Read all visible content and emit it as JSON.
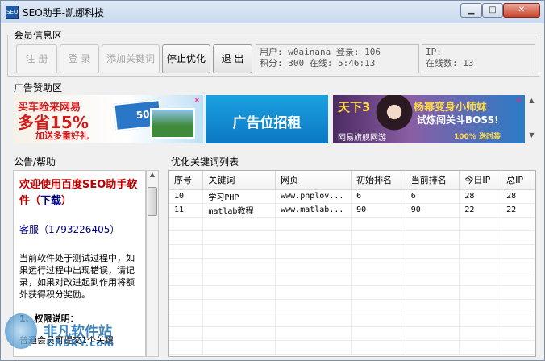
{
  "window": {
    "title": "SEO助手-凯娜科技",
    "app_icon_text": "SEO",
    "min_label": "▁",
    "max_label": "□",
    "close_label": "✕"
  },
  "member": {
    "label": "会员信息区",
    "register": "注 册",
    "login": "登 录",
    "add_keyword": "添加关键词",
    "stop": "停止优化",
    "exit": "退 出",
    "user_line": "用户: w0ainana 登录: 106",
    "score_line": "积分: 300 在线: 5:46:13",
    "ip_line": "IP:",
    "online_line": "在线数: 13"
  },
  "ads": {
    "label": "广告赞助区",
    "ad1_line1": "买车险来网易",
    "ad1_line2": "多省15%",
    "ad1_line3": "加送多重好礼",
    "ad1_badge": "500",
    "ad2_text": "广告位招租",
    "ad3_logo": "天下3",
    "ad3_line1": "杨幂变身小师妹",
    "ad3_line2": "试炼闯关斗BOSS!",
    "ad3_line3": "网易旗舰网游",
    "ad3_badge": "100% 送时装",
    "ad_close": "✕"
  },
  "notice": {
    "label": "公告/帮助",
    "headline": "欢迎使用百度SEO助手软件（",
    "download": "下载",
    "headline_end": "）",
    "service": "客服（1793226405）",
    "paragraph": "当前软件处于测试过程中，如果运行过程中出现错误，请记录，如果对改进起到作用将额外获得积分奖励。",
    "section1": "1、权限说明：",
    "cut_line": "普通会员可提交1个关键"
  },
  "table": {
    "label": "优化关键词列表",
    "columns": [
      "序号",
      "关键词",
      "网页",
      "初始排名",
      "当前排名",
      "今日IP",
      "总IP"
    ],
    "rows": [
      [
        "10",
        "学习PHP",
        "www.phplov...",
        "6",
        "6",
        "28",
        "28"
      ],
      [
        "11",
        "matlab教程",
        "www.matlab...",
        "90",
        "90",
        "22",
        "22"
      ]
    ]
  },
  "watermark": {
    "title": "非凡软件站",
    "sub": "CRSKY.com"
  }
}
